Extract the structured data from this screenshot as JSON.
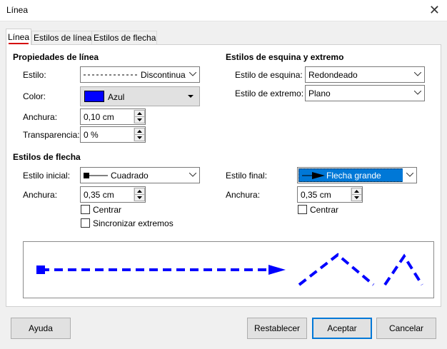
{
  "window": {
    "title": "Línea"
  },
  "tabs": [
    {
      "label": "Línea"
    },
    {
      "label": "Estilos de línea"
    },
    {
      "label": "Estilos de flecha"
    }
  ],
  "line_properties": {
    "title": "Propiedades de línea",
    "style_label": "Estilo:",
    "style_value": "Discontinua",
    "color_label": "Color:",
    "color_value": "Azul",
    "color_swatch": "#0000ff",
    "width_label": "Anchura:",
    "width_value": "0,10 cm",
    "transparency_label": "Transparencia:",
    "transparency_value": "0 %"
  },
  "corner_cap": {
    "title": "Estilos de esquina y extremo",
    "corner_label": "Estilo de esquina:",
    "corner_value": "Redondeado",
    "cap_label": "Estilo de extremo:",
    "cap_value": "Plano"
  },
  "arrow_styles": {
    "title": "Estilos de flecha",
    "start_label": "Estilo inicial:",
    "start_value": "Cuadrado",
    "start_width_label": "Anchura:",
    "start_width_value": "0,35 cm",
    "start_center_label": "Centrar",
    "sync_label": "Sincronizar extremos",
    "end_label": "Estilo final:",
    "end_value": "Flecha grande",
    "end_width_label": "Anchura:",
    "end_width_value": "0,35 cm",
    "end_center_label": "Centrar"
  },
  "preview": {
    "line_color": "#0000ff"
  },
  "buttons": {
    "help": "Ayuda",
    "reset": "Restablecer",
    "ok": "Aceptar",
    "cancel": "Cancelar"
  },
  "colors": {
    "accent": "#0078d7",
    "selection": "#0078d7",
    "tab_underline": "#d40000"
  }
}
